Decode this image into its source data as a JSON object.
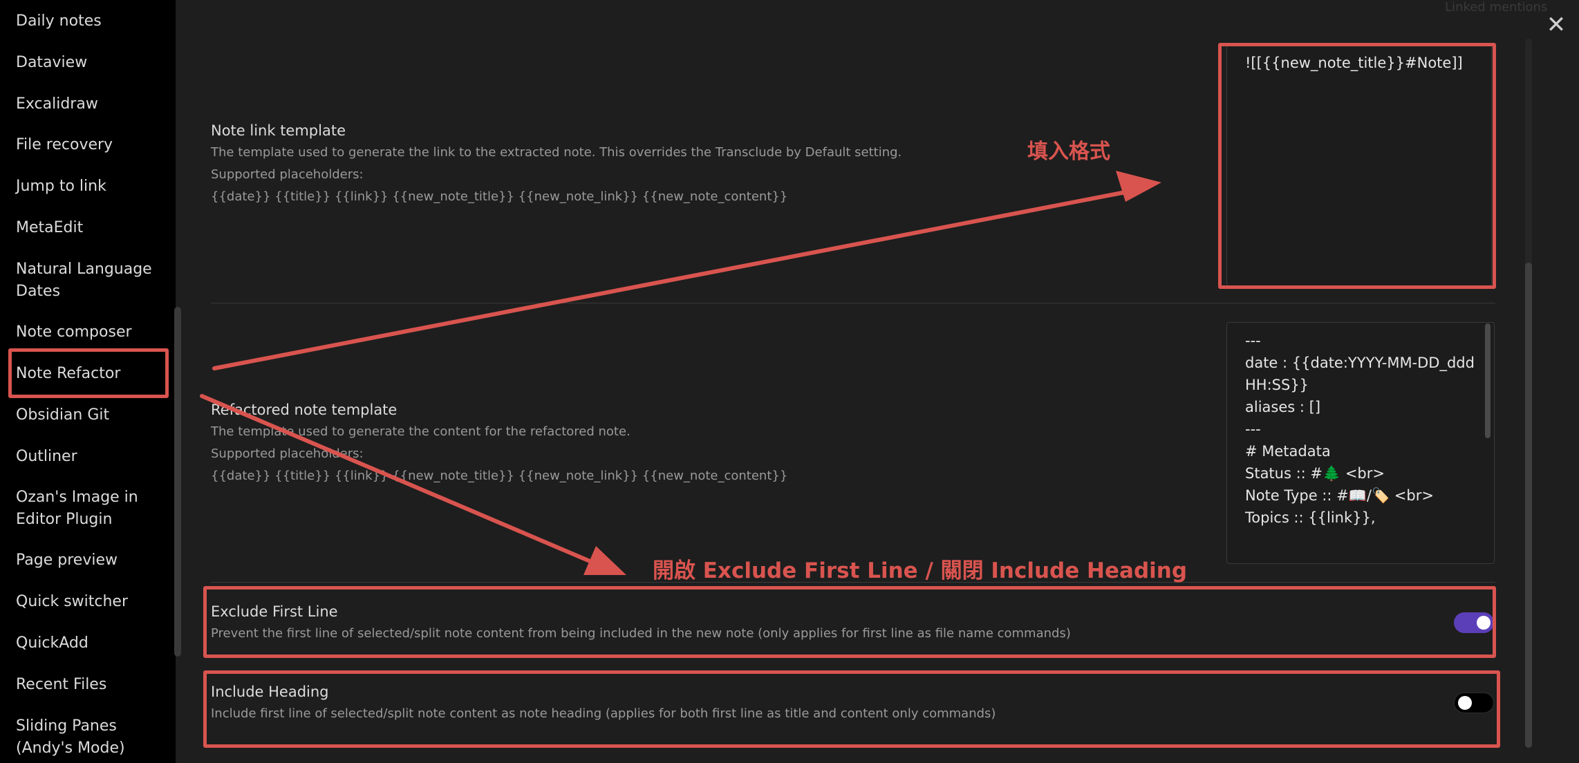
{
  "sidebar": {
    "items": [
      {
        "label": "Daily notes"
      },
      {
        "label": "Dataview"
      },
      {
        "label": "Excalidraw"
      },
      {
        "label": "File recovery"
      },
      {
        "label": "Jump to link"
      },
      {
        "label": "MetaEdit"
      },
      {
        "label": "Natural Language Dates"
      },
      {
        "label": "Note composer"
      },
      {
        "label": "Note Refactor"
      },
      {
        "label": "Obsidian Git"
      },
      {
        "label": "Outliner"
      },
      {
        "label": "Ozan's Image in Editor Plugin"
      },
      {
        "label": "Page preview"
      },
      {
        "label": "Quick switcher"
      },
      {
        "label": "QuickAdd"
      },
      {
        "label": "Recent Files"
      },
      {
        "label": "Sliding Panes (Andy's Mode)"
      }
    ],
    "selected": "Note Refactor"
  },
  "header": {
    "close_label": "✕",
    "faded_top_text": "Linked mentions"
  },
  "settings": {
    "note_link": {
      "name": "Note link template",
      "desc": "The template used to generate the link to the extracted note. This overrides the Transclude by Default setting.",
      "placeholders_label": "Supported placeholders:",
      "placeholders": "{{date}} {{title}} {{link}} {{new_note_title}} {{new_note_link}} {{new_note_content}}",
      "value": "![[{{new_note_title}}#Note]]"
    },
    "refactored": {
      "name": "Refactored note template",
      "desc": "The template used to generate the content for the refactored note.",
      "placeholders_label": "Supported placeholders:",
      "placeholders": "{{date}} {{title}} {{link}} {{new_note_title}} {{new_note_link}} {{new_note_content}}",
      "value": "---\ndate : {{date:YYYY-MM-DD_ddd HH:SS}}\naliases : []\n---\n# Metadata\nStatus :: #🌲 <br>\nNote Type :: #📖/🏷️ <br>\nTopics :: {{link}},"
    },
    "exclude_first_line": {
      "name": "Exclude First Line",
      "desc": "Prevent the first line of selected/split note content from being included in the new note (only applies for first line as file name commands)",
      "enabled": true
    },
    "include_heading": {
      "name": "Include Heading",
      "desc": "Include first line of selected/split note content as note heading (applies for both first line as title and content only commands)",
      "enabled": false
    }
  },
  "annotations": {
    "fill_format": "填入格式",
    "toggle_instruction": "開啟 Exclude First Line / 關閉 Include Heading",
    "color": "#d9544f"
  },
  "colors": {
    "toggle_on": "#5b3fb8",
    "background": "#1e1e1e",
    "sidebar_bg": "#000000"
  }
}
